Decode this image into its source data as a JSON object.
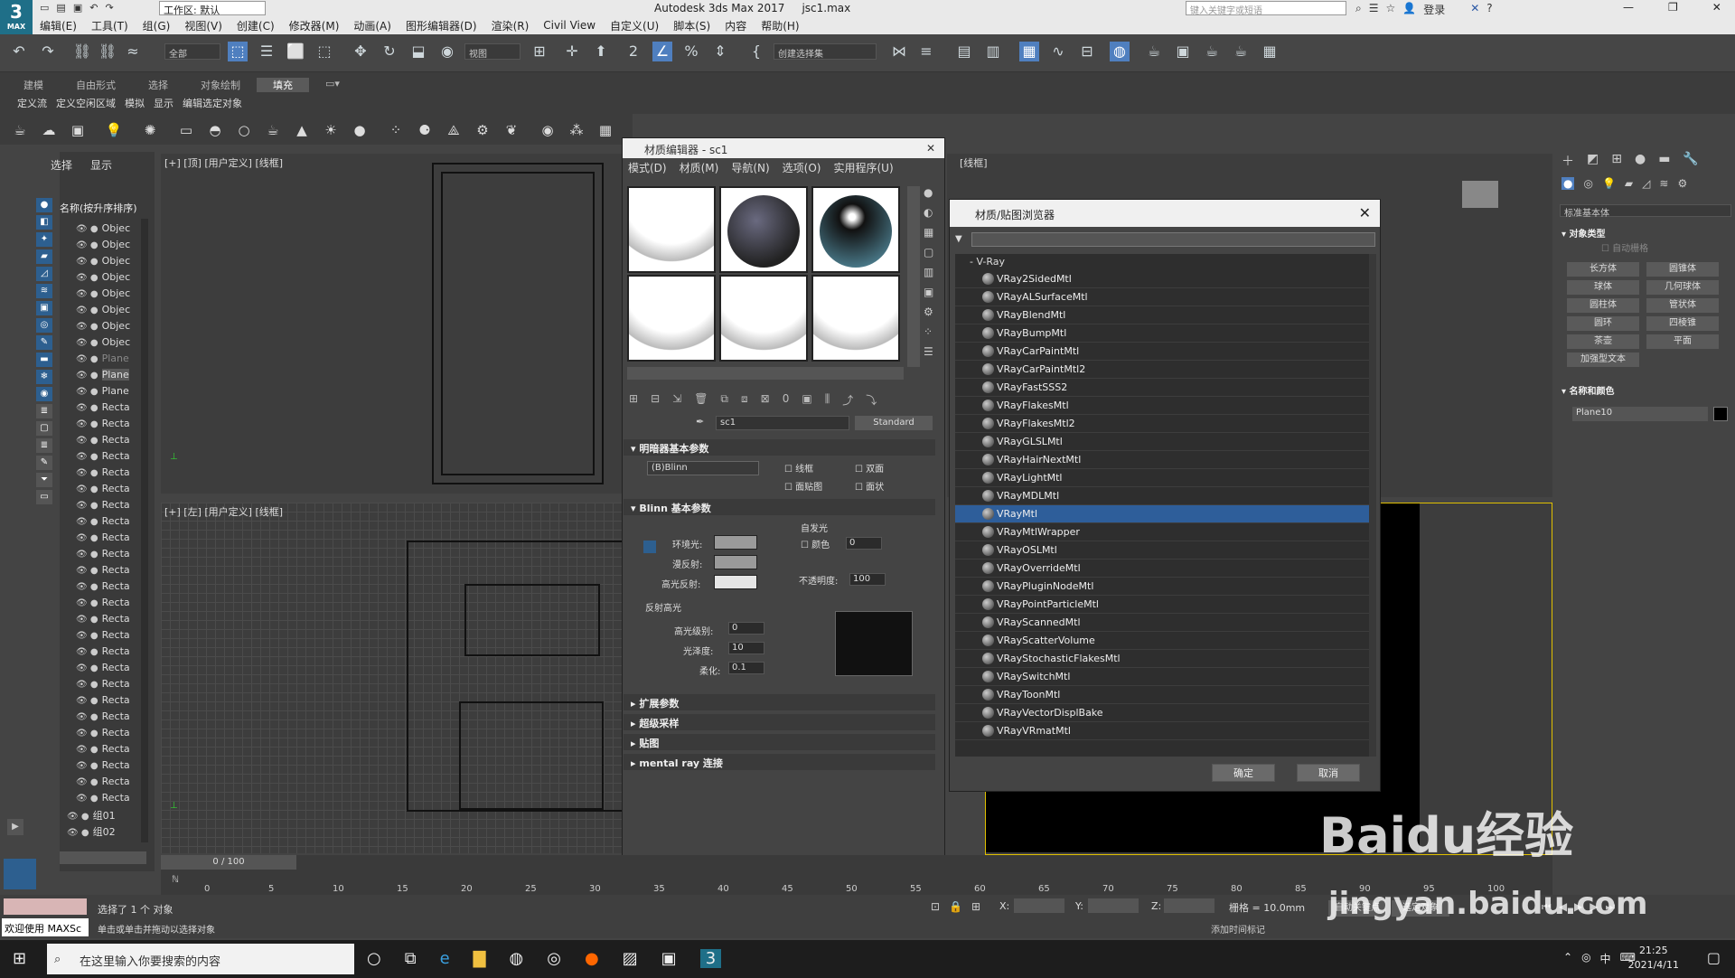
{
  "app": {
    "title": "Autodesk 3ds Max 2017",
    "file": "jsc1.max",
    "workspace": "工作区: 默认",
    "search_placeholder": "键入关键字或短语",
    "login": "登录",
    "logo_text": "MAX"
  },
  "menu": [
    "编辑(E)",
    "工具(T)",
    "组(G)",
    "视图(V)",
    "创建(C)",
    "修改器(M)",
    "动画(A)",
    "图形编辑器(D)",
    "渲染(R)",
    "Civil View",
    "自定义(U)",
    "脚本(S)",
    "内容",
    "帮助(H)"
  ],
  "toolbar": {
    "filter": "全部",
    "view": "视图",
    "selection_set": "创建选择集"
  },
  "ribbon": {
    "tabs": [
      "建模",
      "自由形式",
      "选择",
      "对象绘制",
      "填充"
    ],
    "subtabs": [
      "定义流",
      "定义空闲区域",
      "模拟",
      "显示",
      "编辑选定对象"
    ]
  },
  "explorer": {
    "tabs": [
      "选择",
      "显示"
    ],
    "column": "名称(按升序排序)",
    "rows": [
      "Objec",
      "Objec",
      "Objec",
      "Objec",
      "Objec",
      "Objec",
      "Objec",
      "Objec",
      "Plane",
      "Plane",
      "Plane",
      "Recta",
      "Recta",
      "Recta",
      "Recta",
      "Recta",
      "Recta",
      "Recta",
      "Recta",
      "Recta",
      "Recta",
      "Recta",
      "Recta",
      "Recta",
      "Recta",
      "Recta",
      "Recta",
      "Recta",
      "Recta",
      "Recta",
      "Recta",
      "Recta",
      "Recta",
      "Recta",
      "Recta",
      "Recta",
      "组01",
      "组02"
    ]
  },
  "viewports": {
    "top": "[+] [顶] [用户定义] [线框]",
    "left": "[+] [左] [用户定义] [线框]",
    "right": "[线框]"
  },
  "material_editor": {
    "title": "材质编辑器 - sc1",
    "menu": [
      "模式(D)",
      "材质(M)",
      "导航(N)",
      "选项(O)",
      "实用程序(U)"
    ],
    "name": "sc1",
    "type": "Standard",
    "sections": [
      "明暗器基本参数",
      "Blinn 基本参数",
      "扩展参数",
      "超级采样",
      "贴图",
      "mental ray 连接"
    ],
    "shader": "(B)Blinn",
    "wire": "线框",
    "twosided": "双面",
    "facemap": "面贴图",
    "faceted": "面状",
    "ambient": "环境光:",
    "diffuse": "漫反射:",
    "specular": "高光反射:",
    "self_illum": "自发光",
    "color": "颜色",
    "self_val": "0",
    "opacity_label": "不透明度:",
    "opacity": "100",
    "spec_hl": "反射高光",
    "spec_level_label": "高光级别:",
    "spec_level": "0",
    "gloss_label": "光泽度:",
    "gloss": "10",
    "soften_label": "柔化:",
    "soften": "0.1"
  },
  "browser": {
    "title": "材质/贴图浏览器",
    "group": "- V-Ray",
    "items": [
      "VRay2SidedMtl",
      "VRayALSurfaceMtl",
      "VRayBlendMtl",
      "VRayBumpMtl",
      "VRayCarPaintMtl",
      "VRayCarPaintMtl2",
      "VRayFastSSS2",
      "VRayFlakesMtl",
      "VRayFlakesMtl2",
      "VRayGLSLMtl",
      "VRayHairNextMtl",
      "VRayLightMtl",
      "VRayMDLMtl",
      "VRayMtl",
      "VRayMtlWrapper",
      "VRayOSLMtl",
      "VRayOverrideMtl",
      "VRayPluginNodeMtl",
      "VRayPointParticleMtl",
      "VRayScannedMtl",
      "VRayScatterVolume",
      "VRayStochasticFlakesMtl",
      "VRaySwitchMtl",
      "VRayToonMtl",
      "VRayVectorDisplBake",
      "VRayVRmatMtl"
    ],
    "selected": "VRayMtl",
    "ok": "确定",
    "cancel": "取消"
  },
  "command_panel": {
    "dropdown": "标准基本体",
    "rollout1": "对象类型",
    "autogrid": "自动栅格",
    "buttons": [
      "长方体",
      "圆锥体",
      "球体",
      "几何球体",
      "圆柱体",
      "管状体",
      "圆环",
      "四棱锥",
      "茶壶",
      "平面",
      "加强型文本"
    ],
    "rollout2": "名称和颜色",
    "object_name": "Plane10"
  },
  "timeline": {
    "frame": "0 / 100",
    "ticks": [
      "0",
      "5",
      "10",
      "15",
      "20",
      "25",
      "30",
      "35",
      "40",
      "45",
      "50",
      "55",
      "60",
      "65",
      "70",
      "75",
      "80",
      "85",
      "90",
      "95",
      "100"
    ]
  },
  "status": {
    "welcome": "欢迎使用 MAXSc",
    "selected": "选择了 1 个 对象",
    "hint": "单击或单击并拖动以选择对象",
    "x": "X:",
    "y": "Y:",
    "z": "Z:",
    "grid": "栅格 = 10.0mm",
    "autokey": "自动关键点",
    "setkey": "设置关键点",
    "add_tag": "添加时间标记",
    "selected_obj": "选定对象"
  },
  "taskbar": {
    "search": "在这里输入你要搜索的内容",
    "time": "21:25",
    "date": "2021/4/11",
    "ime": "中"
  },
  "watermark": {
    "brand": "Baidu经验",
    "url": "jingyan.baidu.com"
  },
  "colors": {
    "selection": "#2e5e9a",
    "accent": "#4f7fbf",
    "viewport_frame": "#e0c000"
  }
}
